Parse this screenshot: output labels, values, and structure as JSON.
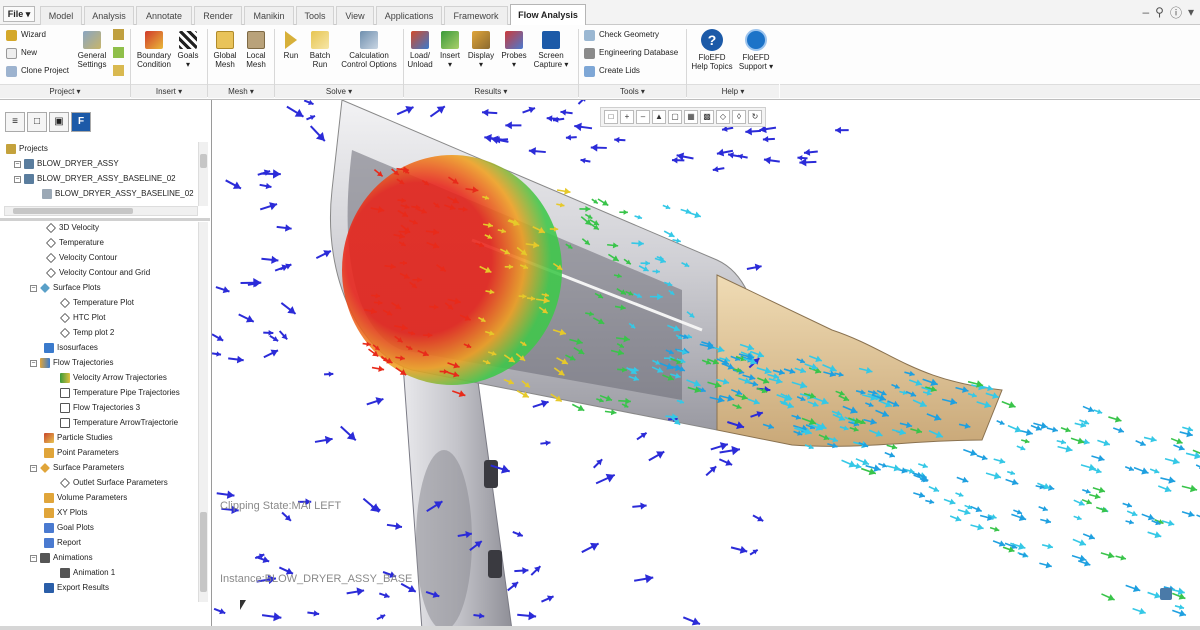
{
  "tabs": {
    "file": "File ▾",
    "items": [
      "Model",
      "Analysis",
      "Annotate",
      "Render",
      "Manikin",
      "Tools",
      "View",
      "Applications",
      "Framework",
      "Flow Analysis"
    ],
    "active": "Flow Analysis"
  },
  "ribbon": {
    "project": {
      "wizard": "Wizard",
      "new": "New",
      "clone": "Clone Project",
      "general_settings": "General\nSettings"
    },
    "insert": {
      "boundary_condition": "Boundary\nCondition",
      "goals": "Goals"
    },
    "mesh": {
      "global_mesh": "Global\nMesh",
      "local_mesh": "Local\nMesh"
    },
    "solve": {
      "run": "Run",
      "batch_run": "Batch\nRun",
      "calc_options": "Calculation\nControl Options"
    },
    "results": {
      "load_unload": "Load/\nUnload",
      "insert": "Insert",
      "display": "Display",
      "probes": "Probes",
      "screen_capture": "Screen\nCapture"
    },
    "tools": {
      "check_geometry": "Check Geometry",
      "engineering_db": "Engineering Database",
      "create_lids": "Create Lids"
    },
    "help": {
      "help_topics": "FloEFD\nHelp Topics",
      "support": "FloEFD\nSupport"
    },
    "groups": {
      "project": "Project ▾",
      "insert": "Insert ▾",
      "mesh": "Mesh ▾",
      "solve": "Solve ▾",
      "results": "Results ▾",
      "tools": "Tools ▾",
      "help": "Help ▾"
    }
  },
  "tree_top": [
    {
      "label": "Projects"
    },
    {
      "label": "BLOW_DRYER_ASSY"
    },
    {
      "label": "BLOW_DRYER_ASSY_BASELINE_02"
    },
    {
      "label": "BLOW_DRYER_ASSY_BASELINE_02"
    }
  ],
  "tree": [
    {
      "label": "3D Velocity"
    },
    {
      "label": "Temperature"
    },
    {
      "label": "Velocity Contour"
    },
    {
      "label": "Velocity Contour and Grid"
    },
    {
      "label": "Surface Plots"
    },
    {
      "label": "Temperature Plot"
    },
    {
      "label": "HTC Plot"
    },
    {
      "label": "Temp plot 2"
    },
    {
      "label": "Isosurfaces"
    },
    {
      "label": "Flow Trajectories"
    },
    {
      "label": "Velocity Arrow Trajectories"
    },
    {
      "label": "Temperature Pipe Trajectories"
    },
    {
      "label": "Flow Trajectories 3"
    },
    {
      "label": "Temperature ArrowTrajectorie"
    },
    {
      "label": "Particle Studies"
    },
    {
      "label": "Point Parameters"
    },
    {
      "label": "Surface Parameters"
    },
    {
      "label": "Outlet Surface Parameters"
    },
    {
      "label": "Volume Parameters"
    },
    {
      "label": "XY Plots"
    },
    {
      "label": "Goal Plots"
    },
    {
      "label": "Report"
    },
    {
      "label": "Animations"
    },
    {
      "label": "Animation 1"
    },
    {
      "label": "Export Results"
    }
  ],
  "viewport": {
    "clipping_state": "Clipping State:MAI LEFT",
    "instance": "Instance:BLOW_DRYER_ASSY_BASE"
  },
  "colors": {
    "accent": "#1c5aa8",
    "arrow_blue": "#2b2bd8",
    "hot": "#e82a1a",
    "cyan": "#35c8e6",
    "green": "#39c44a",
    "shell": "#d9d9dd",
    "nozzle": "#e0c59a"
  }
}
